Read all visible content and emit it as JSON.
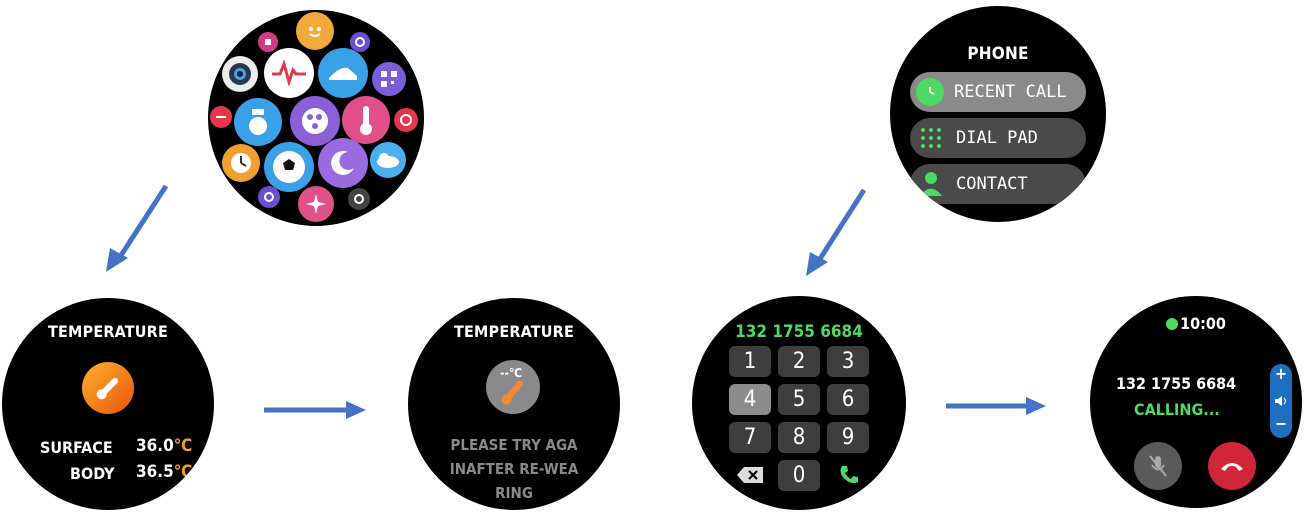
{
  "app_grid": {
    "apps": [
      "music",
      "face",
      "camera",
      "heart-rate",
      "sports",
      "qr-code",
      "no-disturb",
      "breathing",
      "games",
      "thermometer",
      "alarm",
      "timer",
      "football",
      "sleep",
      "weather",
      "reset",
      "flower",
      "settings"
    ]
  },
  "temp1": {
    "title": "TEMPERATURE",
    "surface_label": "SURFACE",
    "surface_value": "36.0",
    "body_label": "BODY",
    "body_value": "36.5",
    "unit": "℃"
  },
  "temp2": {
    "title": "TEMPERATURE",
    "reading": "--℃",
    "message_line1": "PLEASE TRY AGA",
    "message_line2": "INAFTER RE-WEA",
    "message_line3": "RING"
  },
  "phone_menu": {
    "title": "PHONE",
    "items": [
      {
        "label": "RECENT CALL"
      },
      {
        "label": "DIAL PAD"
      },
      {
        "label": "CONTACT"
      }
    ]
  },
  "dialpad": {
    "number": "132 1755 6684",
    "keys": [
      "1",
      "2",
      "3",
      "4",
      "5",
      "6",
      "7",
      "8",
      "9",
      "0"
    ]
  },
  "calling": {
    "time": "10:00",
    "number": "132 1755 6684",
    "status": "CALLING...",
    "vol_up": "+",
    "vol_down": "−"
  },
  "colors": {
    "arrow": "#4472c4",
    "green": "#4cd964",
    "orange": "#f0a020",
    "red": "#d0263a"
  }
}
